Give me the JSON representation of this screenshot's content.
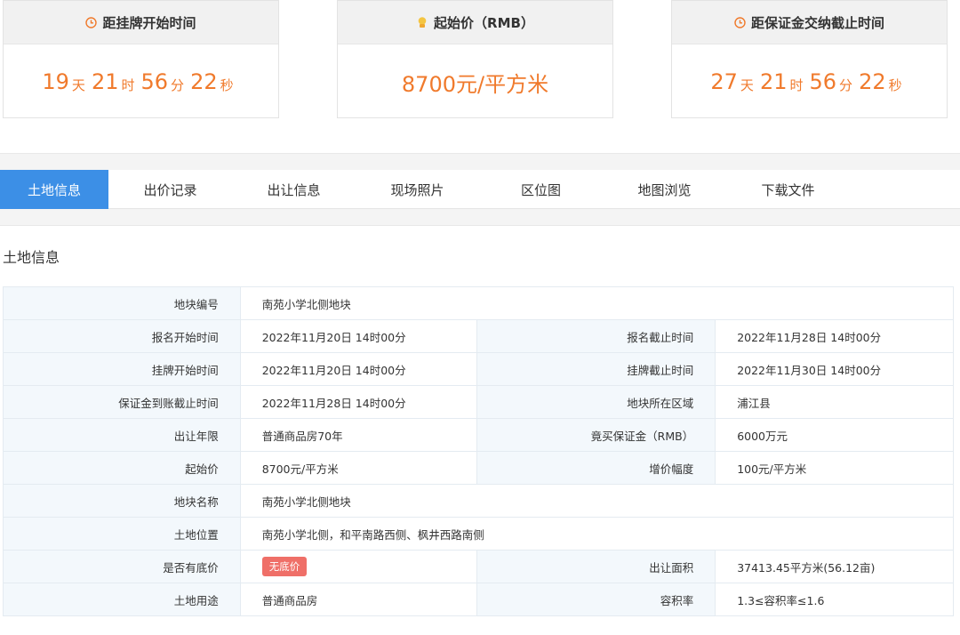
{
  "cards": [
    {
      "title": "距挂牌开始时间",
      "icon": "clock-icon",
      "days": "19",
      "days_unit": "天",
      "hours": "21",
      "hours_unit": "时",
      "minutes": "56",
      "minutes_unit": "分",
      "seconds": "22",
      "seconds_unit": "秒"
    },
    {
      "title": "起始价（RMB）",
      "icon": "coin-icon",
      "price": "8700元/平方米"
    },
    {
      "title": "距保证金交纳截止时间",
      "icon": "clock-icon",
      "days": "27",
      "days_unit": "天",
      "hours": "21",
      "hours_unit": "时",
      "minutes": "56",
      "minutes_unit": "分",
      "seconds": "22",
      "seconds_unit": "秒"
    }
  ],
  "tabs": [
    "土地信息",
    "出价记录",
    "出让信息",
    "现场照片",
    "区位图",
    "地图浏览",
    "下载文件"
  ],
  "section_title": "土地信息",
  "rows": [
    {
      "l1": "地块编号",
      "v1": "南苑小学北侧地块"
    },
    {
      "l1": "报名开始时间",
      "v1": "2022年11月20日 14时00分",
      "l2": "报名截止时间",
      "v2": "2022年11月28日 14时00分"
    },
    {
      "l1": "挂牌开始时间",
      "v1": "2022年11月20日 14时00分",
      "l2": "挂牌截止时间",
      "v2": "2022年11月30日 14时00分"
    },
    {
      "l1": "保证金到账截止时间",
      "v1": "2022年11月28日 14时00分",
      "l2": "地块所在区域",
      "v2": "浦江县"
    },
    {
      "l1": "出让年限",
      "v1": "普通商品房70年",
      "l2": "竟买保证金（RMB）",
      "v2": "6000万元"
    },
    {
      "l1": "起始价",
      "v1": "8700元/平方米",
      "l2": "增价幅度",
      "v2": "100元/平方米"
    },
    {
      "l1": "地块名称",
      "v1": "南苑小学北侧地块"
    },
    {
      "l1": "土地位置",
      "v1": "南苑小学北侧，和平南路西侧、枫井西路南侧"
    },
    {
      "l1": "是否有底价",
      "v1": "无底价",
      "l2": "出让面积",
      "v2": "37413.45平方米(56.12亩)"
    },
    {
      "l1": "土地用途",
      "v1": "普通商品房",
      "l2": "容积率",
      "v2": "1.3≤容积率≤1.6"
    }
  ],
  "colors": {
    "accent": "#3c8fe6",
    "countdown": "#f07a2c",
    "badge": "#ef6f68"
  }
}
